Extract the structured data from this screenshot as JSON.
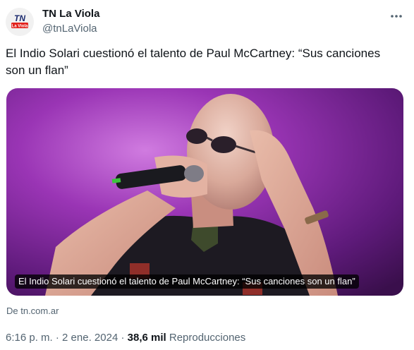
{
  "account": {
    "name": "TN La Viola",
    "handle": "@tnLaViola",
    "avatar_logo_text": "TN La Viola",
    "brand_color": "#e2211c"
  },
  "tweet": {
    "text": "El Indio Solari cuestionó el talento de Paul McCartney: “Sus canciones son un flan”"
  },
  "card": {
    "caption": "El Indio Solari cuestionó el talento de Paul McCartney: “Sus canciones son un flan”",
    "source": "De tn.com.ar"
  },
  "meta": {
    "time": "6:16 p. m.",
    "sep1": "·",
    "date": "2 ene. 2024",
    "sep2": "·",
    "views_count": "38,6 mil",
    "views_label": "Reproducciones"
  },
  "icons": {
    "more": "more-horizontal-icon",
    "avatar": "tn-la-viola-logo"
  },
  "colors": {
    "text_primary": "#0f1419",
    "text_secondary": "#536471",
    "photo_background": "#8a2aa3"
  }
}
